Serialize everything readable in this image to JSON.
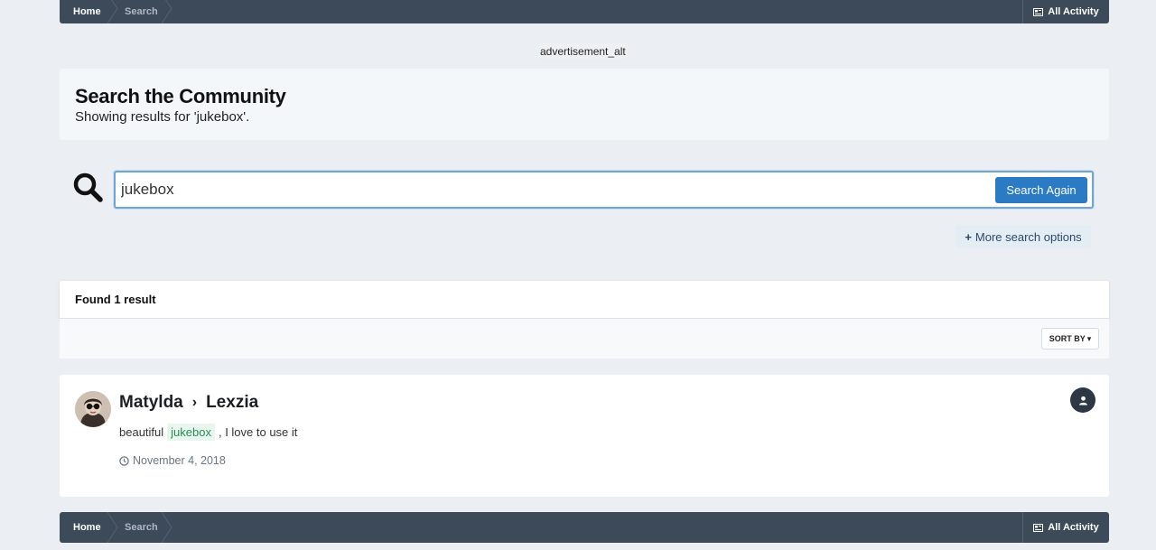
{
  "breadcrumb": {
    "home": "Home",
    "search": "Search",
    "all_activity": "All Activity"
  },
  "ad": {
    "alt_text": "advertisement_alt"
  },
  "header": {
    "title": "Search the Community",
    "subtitle": "Showing results for 'jukebox'."
  },
  "search": {
    "value": "jukebox",
    "button_label": "Search Again",
    "more_options": "More search options"
  },
  "results": {
    "count_label": "Found 1 result",
    "sort_label": "SORT BY",
    "items": [
      {
        "author": "Matylda",
        "target": "Lexzia",
        "snippet_before": "beautiful",
        "highlight": "jukebox",
        "snippet_after": ", I love to use it",
        "date": "November 4, 2018",
        "type_icon": "user-icon"
      }
    ]
  },
  "colors": {
    "page_bg": "#ebeef2",
    "breadcrumb_bg": "#3d4a5a",
    "button_blue": "#2a7ac4",
    "highlight_green": "#2e8a57"
  }
}
